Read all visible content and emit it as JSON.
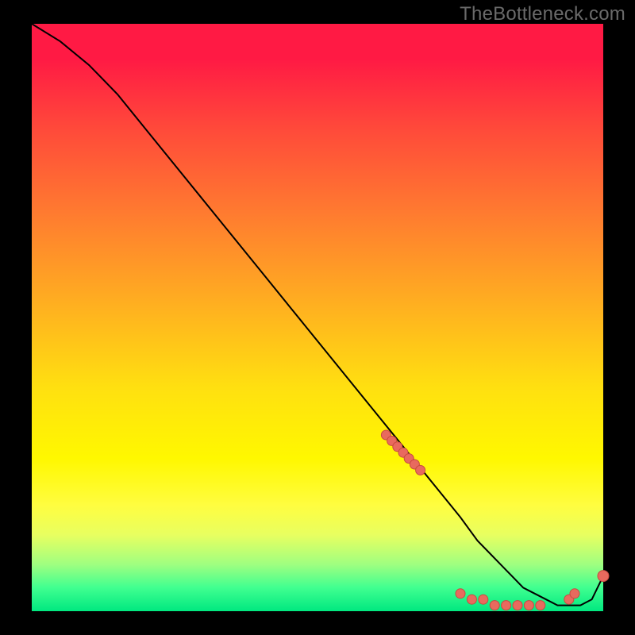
{
  "watermark": "TheBottleneck.com",
  "chart_data": {
    "type": "line",
    "title": "",
    "xlabel": "",
    "ylabel": "",
    "xlim": [
      0,
      100
    ],
    "ylim": [
      0,
      100
    ],
    "series": [
      {
        "name": "bottleneck-curve",
        "x": [
          0,
          5,
          10,
          15,
          20,
          25,
          30,
          35,
          40,
          45,
          50,
          55,
          60,
          65,
          70,
          75,
          78,
          80,
          82,
          84,
          86,
          88,
          90,
          92,
          94,
          96,
          98,
          100
        ],
        "y": [
          100,
          97,
          93,
          88,
          82,
          76,
          70,
          64,
          58,
          52,
          46,
          40,
          34,
          28,
          22,
          16,
          12,
          10,
          8,
          6,
          4,
          3,
          2,
          1,
          1,
          1,
          2,
          6
        ]
      }
    ],
    "markers_red": {
      "x": [
        62,
        63,
        64,
        65,
        66,
        67,
        68,
        75,
        77,
        79,
        81,
        83,
        85,
        87,
        89,
        94,
        95
      ],
      "y": [
        30,
        29,
        28,
        27,
        26,
        25,
        24,
        3,
        2,
        2,
        1,
        1,
        1,
        1,
        1,
        2,
        3
      ]
    },
    "end_marker": {
      "x": 100,
      "y": 6
    }
  },
  "style": {
    "curve_stroke": "#000000",
    "curve_width": 2,
    "marker_fill": "#e86a5e",
    "marker_stroke": "#c84a40",
    "marker_radius": 6,
    "end_marker_radius": 7
  }
}
